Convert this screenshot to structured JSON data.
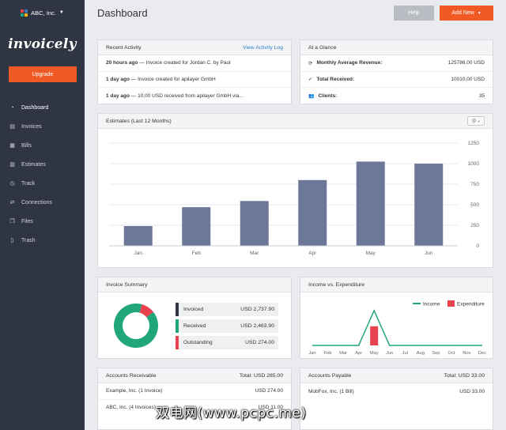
{
  "company": {
    "name": "ABC, Inc."
  },
  "logo": "invoicely",
  "upgrade_label": "Upgrade",
  "nav": [
    {
      "label": "Dashboard",
      "icon": "dashboard-icon"
    },
    {
      "label": "Invoices",
      "icon": "invoice-icon"
    },
    {
      "label": "Bills",
      "icon": "bill-icon"
    },
    {
      "label": "Estimates",
      "icon": "estimate-icon"
    },
    {
      "label": "Track",
      "icon": "track-icon"
    },
    {
      "label": "Connections",
      "icon": "connections-icon"
    },
    {
      "label": "Files",
      "icon": "files-icon"
    },
    {
      "label": "Trash",
      "icon": "trash-icon"
    }
  ],
  "header": {
    "title": "Dashboard",
    "help_label": "Help",
    "add_label": "Add New"
  },
  "recent": {
    "title": "Recent Activity",
    "link": "View Activity Log",
    "items": [
      {
        "time": "20 hours ago",
        "text": " — Invoice created for Jordan C. by Paul"
      },
      {
        "time": "1 day ago",
        "text": " — Invoice created for apilayer GmbH"
      },
      {
        "time": "1 day ago",
        "text": " — 10,00 USD received from apilayer GmbH via..."
      }
    ]
  },
  "glance": {
    "title": "At a Glance",
    "items": [
      {
        "label": "Monthly Average Revenue:",
        "value": "125786,00 USD",
        "icon": "refresh-icon"
      },
      {
        "label": "Total Received:",
        "value": "10010,00 USD",
        "icon": "check-icon"
      },
      {
        "label": "Clients:",
        "value": "35",
        "icon": "users-icon"
      }
    ]
  },
  "estimates": {
    "title": "Estimates (Last 12 Months)"
  },
  "invoice_summary": {
    "title": "Invoice Summary",
    "items": [
      {
        "label": "Invoiced",
        "value": "USD 2,737.90",
        "color": "#2f3542"
      },
      {
        "label": "Received",
        "value": "USD 2,463.90",
        "color": "#1fa67a"
      },
      {
        "label": "Outstanding",
        "value": "USD 274.00",
        "color": "#e8424f"
      }
    ]
  },
  "income_expenditure": {
    "title": "Income vs. Expenditure",
    "legend_income": "Income",
    "legend_expenditure": "Expenditure",
    "income_color": "#1fa67a",
    "expenditure_color": "#e8424f"
  },
  "receivable": {
    "title": "Accounts Receivable",
    "total": "Total: USD 285.00",
    "rows": [
      {
        "name": "Example, Inc. (1 Invoice)",
        "value": "USD 274.00"
      },
      {
        "name": "ABC, Inc. (4 Invoices)",
        "value": "USD 11.00"
      }
    ]
  },
  "payable": {
    "title": "Accounts Payable",
    "total": "Total: USD 33.00",
    "rows": [
      {
        "name": "MobFox, Inc. (1 Bill)",
        "value": "USD 33.00"
      }
    ]
  },
  "watermark": "双电网(www.pcpc.me)",
  "chart_data": [
    {
      "type": "bar",
      "title": "Estimates (Last 12 Months)",
      "categories": [
        "Jan",
        "Feb",
        "Mar",
        "Apr",
        "May",
        "Jun"
      ],
      "values": [
        240,
        470,
        545,
        800,
        1025,
        1000
      ],
      "ylim": [
        0,
        1250
      ],
      "yticks": [
        0,
        250,
        500,
        750,
        1000,
        1250
      ],
      "bar_color": "#6d7797",
      "grid": true
    },
    {
      "type": "pie",
      "title": "Invoice Summary",
      "categories": [
        "Received",
        "Outstanding"
      ],
      "values": [
        2463.9,
        274.0
      ],
      "colors": [
        "#1fa67a",
        "#e8424f"
      ]
    },
    {
      "type": "line",
      "title": "Income vs. Expenditure",
      "categories": [
        "Jan",
        "Feb",
        "Mar",
        "Apr",
        "May",
        "Jun",
        "Jul",
        "Aug",
        "Sep",
        "Oct",
        "Nov",
        "Dec"
      ],
      "series": [
        {
          "name": "Income",
          "values": [
            0,
            0,
            0,
            0,
            1,
            0,
            0,
            0,
            0,
            0,
            0,
            0
          ]
        },
        {
          "name": "Expenditure",
          "values": [
            0,
            0,
            0,
            0,
            0.55,
            0,
            0,
            0,
            0,
            0,
            0,
            0
          ]
        }
      ]
    }
  ]
}
